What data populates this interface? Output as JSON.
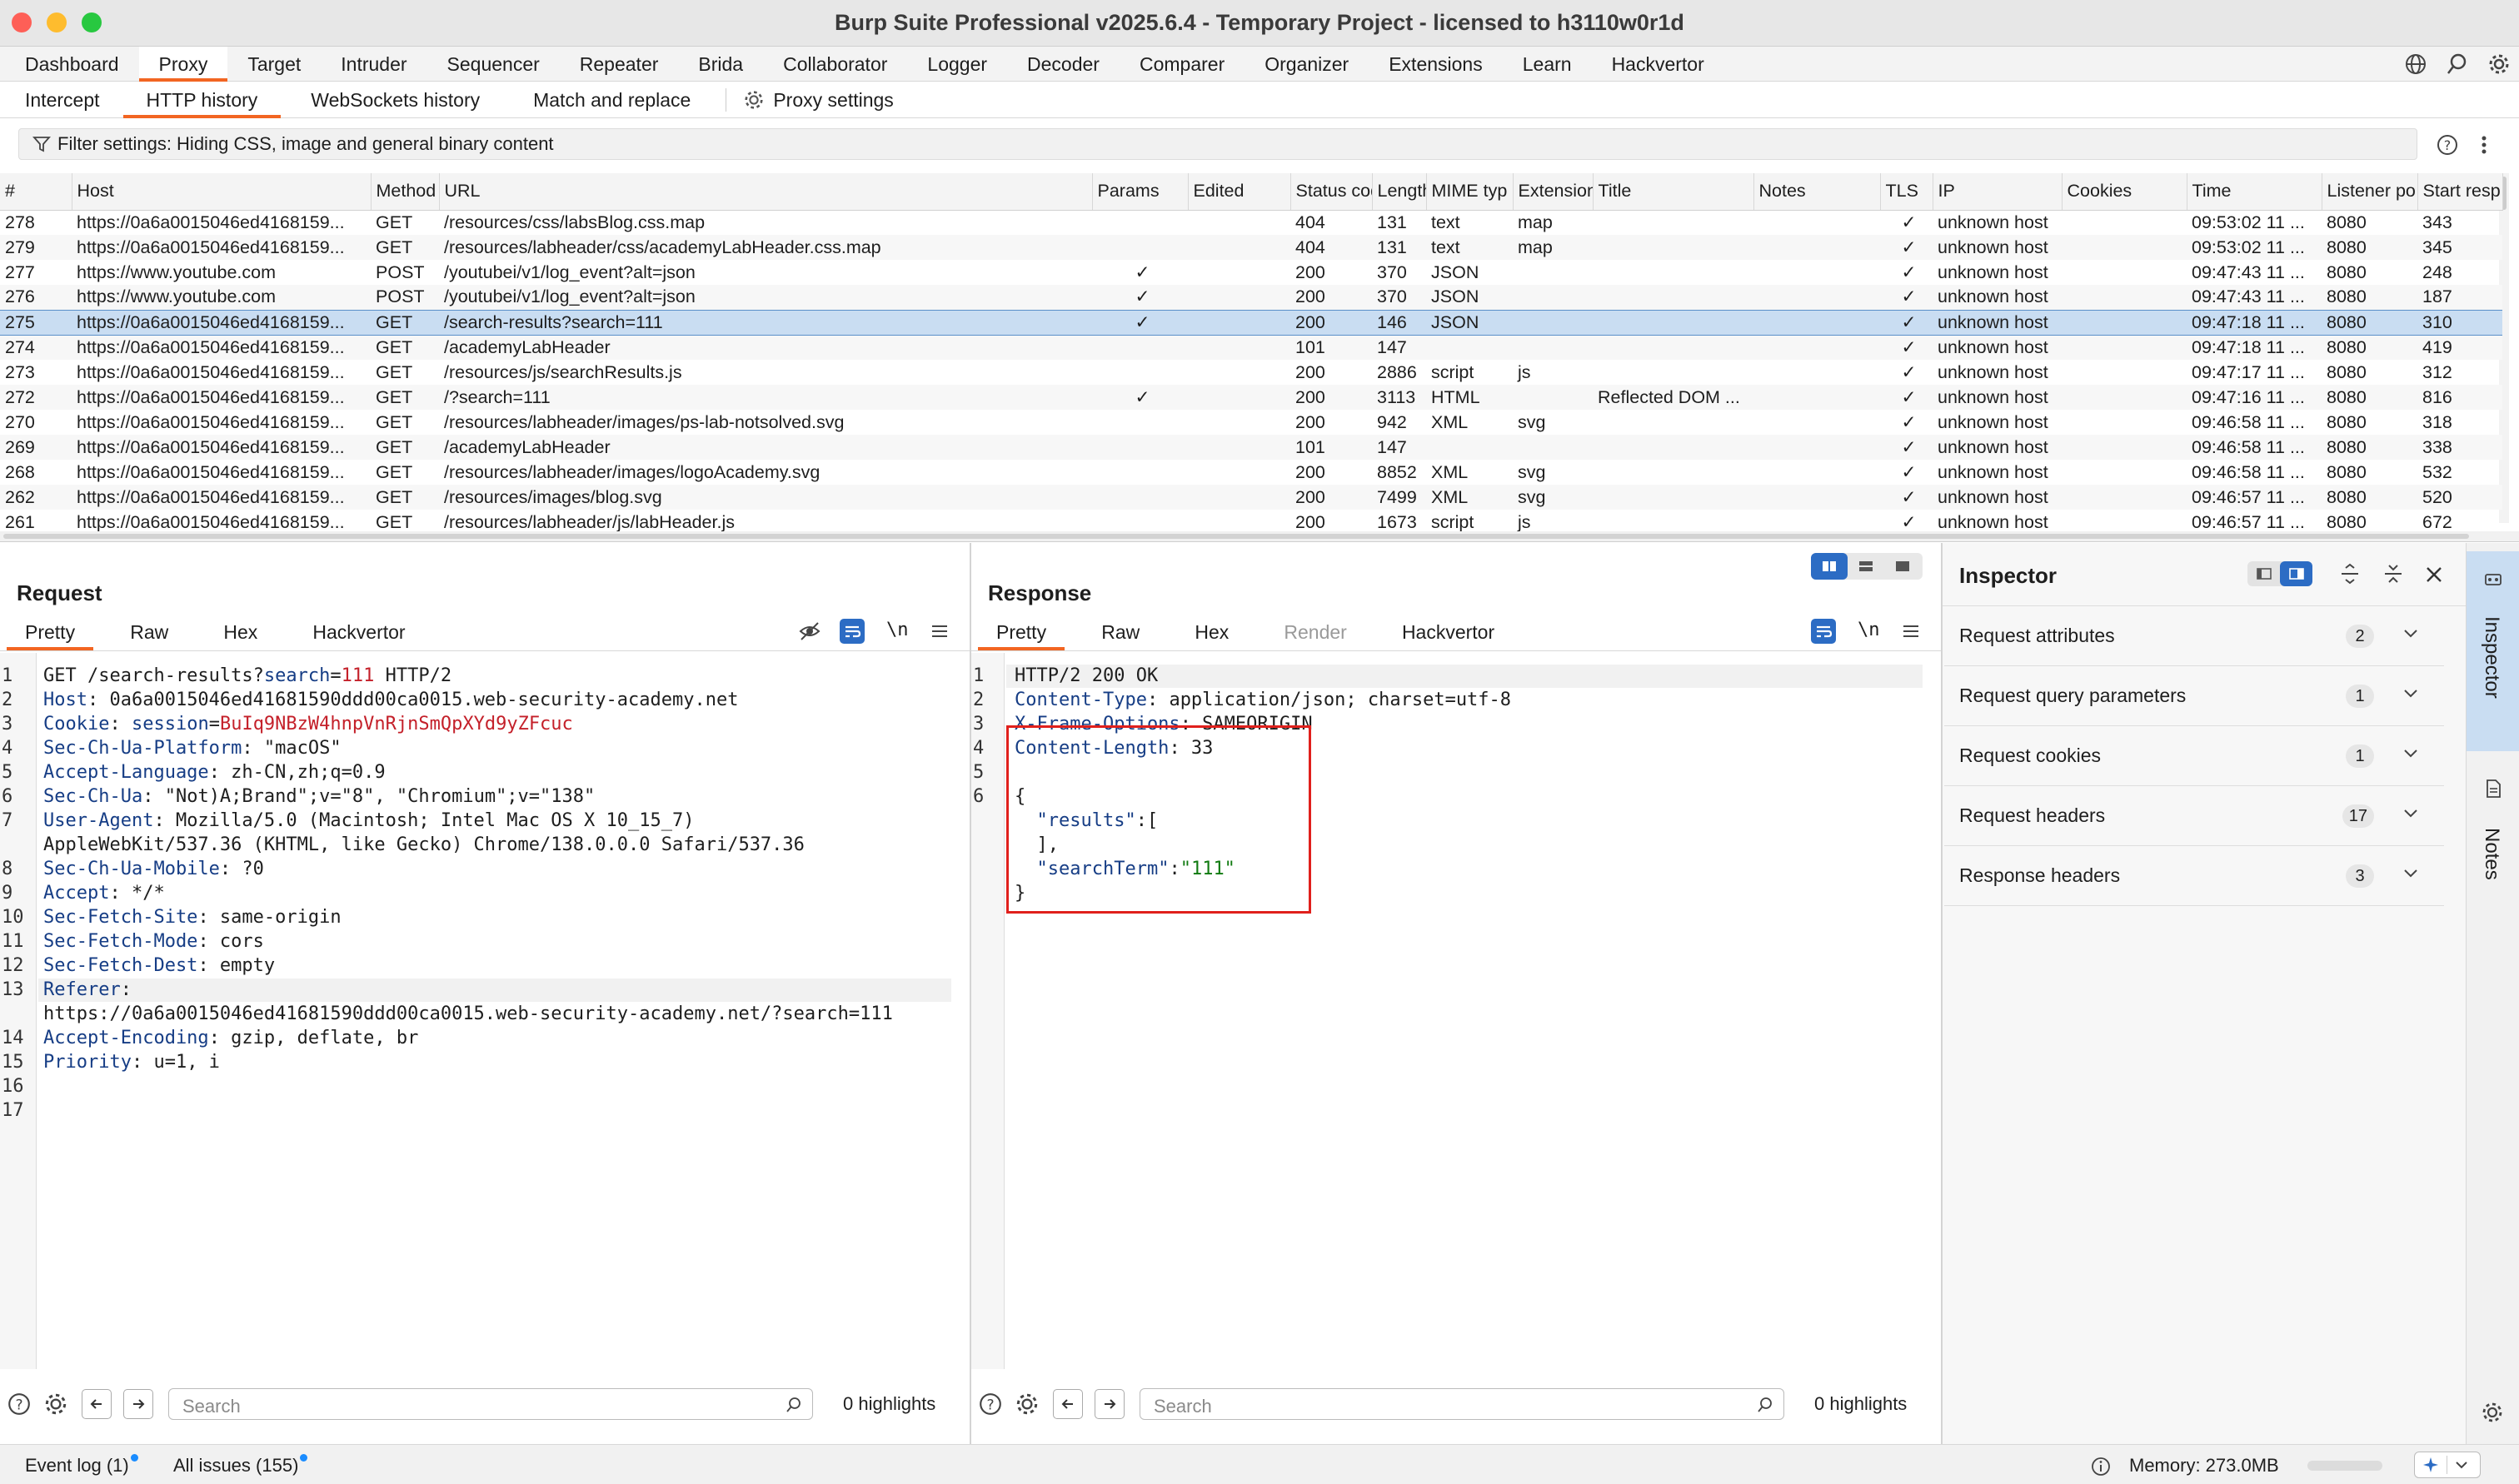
{
  "window": {
    "title": "Burp Suite Professional v2025.6.4 - Temporary Project - licensed to h3110w0r1d"
  },
  "main_tabs": [
    "Dashboard",
    "Proxy",
    "Target",
    "Intruder",
    "Sequencer",
    "Repeater",
    "Brida",
    "Collaborator",
    "Logger",
    "Decoder",
    "Comparer",
    "Organizer",
    "Extensions",
    "Learn",
    "Hackvertor"
  ],
  "active_main_tab": "Proxy",
  "sub_tabs": [
    "Intercept",
    "HTTP history",
    "WebSockets history",
    "Match and replace",
    "Proxy settings"
  ],
  "active_sub_tab": "HTTP history",
  "filter": {
    "text": "Filter settings: Hiding CSS, image and general binary content"
  },
  "table": {
    "columns": [
      "#",
      "Host",
      "Method",
      "URL",
      "Params",
      "Edited",
      "Status code",
      "Length",
      "MIME typ",
      "Extension",
      "Title",
      "Notes",
      "TLS",
      "IP",
      "Cookies",
      "Time",
      "Listener po",
      "Start resp"
    ],
    "rows": [
      [
        "278",
        "https://0a6a0015046ed4168159...",
        "GET",
        "/resources/css/labsBlog.css.map",
        "",
        "",
        "404",
        "131",
        "text",
        "map",
        "",
        "",
        "✓",
        "unknown host",
        "",
        "09:53:02 11 ...",
        "8080",
        "343"
      ],
      [
        "279",
        "https://0a6a0015046ed4168159...",
        "GET",
        "/resources/labheader/css/academyLabHeader.css.map",
        "",
        "",
        "404",
        "131",
        "text",
        "map",
        "",
        "",
        "✓",
        "unknown host",
        "",
        "09:53:02 11 ...",
        "8080",
        "345"
      ],
      [
        "277",
        "https://www.youtube.com",
        "POST",
        "/youtubei/v1/log_event?alt=json",
        "✓",
        "",
        "200",
        "370",
        "JSON",
        "",
        "",
        "",
        "✓",
        "unknown host",
        "",
        "09:47:43 11 ...",
        "8080",
        "248"
      ],
      [
        "276",
        "https://www.youtube.com",
        "POST",
        "/youtubei/v1/log_event?alt=json",
        "✓",
        "",
        "200",
        "370",
        "JSON",
        "",
        "",
        "",
        "✓",
        "unknown host",
        "",
        "09:47:43 11 ...",
        "8080",
        "187"
      ],
      [
        "275",
        "https://0a6a0015046ed4168159...",
        "GET",
        "/search-results?search=111",
        "✓",
        "",
        "200",
        "146",
        "JSON",
        "",
        "",
        "",
        "✓",
        "unknown host",
        "",
        "09:47:18 11 ...",
        "8080",
        "310"
      ],
      [
        "274",
        "https://0a6a0015046ed4168159...",
        "GET",
        "/academyLabHeader",
        "",
        "",
        "101",
        "147",
        "",
        "",
        "",
        "",
        "✓",
        "unknown host",
        "",
        "09:47:18 11 ...",
        "8080",
        "419"
      ],
      [
        "273",
        "https://0a6a0015046ed4168159...",
        "GET",
        "/resources/js/searchResults.js",
        "",
        "",
        "200",
        "2886",
        "script",
        "js",
        "",
        "",
        "✓",
        "unknown host",
        "",
        "09:47:17 11 ...",
        "8080",
        "312"
      ],
      [
        "272",
        "https://0a6a0015046ed4168159...",
        "GET",
        "/?search=111",
        "✓",
        "",
        "200",
        "3113",
        "HTML",
        "",
        "Reflected DOM ...",
        "",
        "✓",
        "unknown host",
        "",
        "09:47:16 11 ...",
        "8080",
        "816"
      ],
      [
        "270",
        "https://0a6a0015046ed4168159...",
        "GET",
        "/resources/labheader/images/ps-lab-notsolved.svg",
        "",
        "",
        "200",
        "942",
        "XML",
        "svg",
        "",
        "",
        "✓",
        "unknown host",
        "",
        "09:46:58 11 ...",
        "8080",
        "318"
      ],
      [
        "269",
        "https://0a6a0015046ed4168159...",
        "GET",
        "/academyLabHeader",
        "",
        "",
        "101",
        "147",
        "",
        "",
        "",
        "",
        "✓",
        "unknown host",
        "",
        "09:46:58 11 ...",
        "8080",
        "338"
      ],
      [
        "268",
        "https://0a6a0015046ed4168159...",
        "GET",
        "/resources/labheader/images/logoAcademy.svg",
        "",
        "",
        "200",
        "8852",
        "XML",
        "svg",
        "",
        "",
        "✓",
        "unknown host",
        "",
        "09:46:58 11 ...",
        "8080",
        "532"
      ],
      [
        "262",
        "https://0a6a0015046ed4168159...",
        "GET",
        "/resources/images/blog.svg",
        "",
        "",
        "200",
        "7499",
        "XML",
        "svg",
        "",
        "",
        "✓",
        "unknown host",
        "",
        "09:46:57 11 ...",
        "8080",
        "520"
      ],
      [
        "261",
        "https://0a6a0015046ed4168159...",
        "GET",
        "/resources/labheader/js/labHeader.js",
        "",
        "",
        "200",
        "1673",
        "script",
        "js",
        "",
        "",
        "✓",
        "unknown host",
        "",
        "09:46:57 11 ...",
        "8080",
        "672"
      ]
    ],
    "selected_row": "275"
  },
  "request": {
    "title": "Request",
    "tabs": [
      "Pretty",
      "Raw",
      "Hex",
      "Hackvertor"
    ],
    "active_tab": "Pretty",
    "newline_toggle": "\\n",
    "lines": [
      {
        "n": "1",
        "parts": [
          [
            "hv",
            "GET /search-results?"
          ],
          [
            "hk",
            "search"
          ],
          [
            "hv",
            "="
          ],
          [
            "qv",
            "111"
          ],
          [
            "hv",
            " HTTP/2"
          ]
        ]
      },
      {
        "n": "2",
        "parts": [
          [
            "hk",
            "Host"
          ],
          [
            "hv",
            ": 0a6a0015046ed41681590ddd00ca0015.web-security-academy.net"
          ]
        ]
      },
      {
        "n": "3",
        "parts": [
          [
            "hk",
            "Cookie"
          ],
          [
            "hv",
            ": "
          ],
          [
            "hk",
            "session"
          ],
          [
            "hv",
            "="
          ],
          [
            "pk",
            "BuIq9NBzW4hnpVnRjnSmQpXYd9yZFcuc"
          ]
        ]
      },
      {
        "n": "4",
        "parts": [
          [
            "hk",
            "Sec-Ch-Ua-Platform"
          ],
          [
            "hv",
            ": \"macOS\""
          ]
        ]
      },
      {
        "n": "5",
        "parts": [
          [
            "hk",
            "Accept-Language"
          ],
          [
            "hv",
            ": zh-CN,zh;q=0.9"
          ]
        ]
      },
      {
        "n": "6",
        "parts": [
          [
            "hk",
            "Sec-Ch-Ua"
          ],
          [
            "hv",
            ": \"Not)A;Brand\";v=\"8\", \"Chromium\";v=\"138\""
          ]
        ]
      },
      {
        "n": "7",
        "parts": [
          [
            "hk",
            "User-Agent"
          ],
          [
            "hv",
            ": Mozilla/5.0 (Macintosh; Intel Mac OS X 10_15_7)"
          ]
        ]
      },
      {
        "n": "",
        "parts": [
          [
            "hv",
            "AppleWebKit/537.36 (KHTML, like Gecko) Chrome/138.0.0.0 Safari/537.36"
          ]
        ]
      },
      {
        "n": "8",
        "parts": [
          [
            "hk",
            "Sec-Ch-Ua-Mobile"
          ],
          [
            "hv",
            ": ?0"
          ]
        ]
      },
      {
        "n": "9",
        "parts": [
          [
            "hk",
            "Accept"
          ],
          [
            "hv",
            ": */*"
          ]
        ]
      },
      {
        "n": "10",
        "parts": [
          [
            "hk",
            "Sec-Fetch-Site"
          ],
          [
            "hv",
            ": same-origin"
          ]
        ]
      },
      {
        "n": "11",
        "parts": [
          [
            "hk",
            "Sec-Fetch-Mode"
          ],
          [
            "hv",
            ": cors"
          ]
        ]
      },
      {
        "n": "12",
        "parts": [
          [
            "hk",
            "Sec-Fetch-Dest"
          ],
          [
            "hv",
            ": empty"
          ]
        ]
      },
      {
        "n": "13",
        "parts": [
          [
            "hk",
            "Referer"
          ],
          [
            "hv",
            ": "
          ]
        ]
      },
      {
        "n": "",
        "parts": [
          [
            "hv",
            "https://0a6a0015046ed41681590ddd00ca0015.web-security-academy.net/?search=111"
          ]
        ]
      },
      {
        "n": "14",
        "parts": [
          [
            "hk",
            "Accept-Encoding"
          ],
          [
            "hv",
            ": gzip, deflate, br"
          ]
        ]
      },
      {
        "n": "15",
        "parts": [
          [
            "hk",
            "Priority"
          ],
          [
            "hv",
            ": u=1, i"
          ]
        ]
      },
      {
        "n": "16",
        "parts": []
      },
      {
        "n": "17",
        "parts": []
      }
    ],
    "search_placeholder": "Search",
    "highlights": "0 highlights"
  },
  "response": {
    "title": "Response",
    "tabs": [
      "Pretty",
      "Raw",
      "Hex",
      "Render",
      "Hackvertor"
    ],
    "active_tab": "Pretty",
    "newline_toggle": "\\n",
    "lines": [
      {
        "n": "1",
        "parts": [
          [
            "hv",
            "HTTP/2 200 OK"
          ]
        ]
      },
      {
        "n": "2",
        "parts": [
          [
            "hk",
            "Content-Type"
          ],
          [
            "hv",
            ": application/json; charset=utf-8"
          ]
        ]
      },
      {
        "n": "3",
        "parts": [
          [
            "hk",
            "X-Frame-Options"
          ],
          [
            "hv",
            ": SAMEORIGIN"
          ]
        ]
      },
      {
        "n": "4",
        "parts": [
          [
            "hk",
            "Content-Length"
          ],
          [
            "hv",
            ": 33"
          ]
        ]
      },
      {
        "n": "5",
        "parts": []
      },
      {
        "n": "6",
        "parts": [
          [
            "hv",
            "{"
          ]
        ]
      },
      {
        "n": "",
        "parts": [
          [
            "hv",
            "  "
          ],
          [
            "jk",
            "\"results\""
          ],
          [
            "hv",
            ":["
          ]
        ]
      },
      {
        "n": "",
        "parts": [
          [
            "hv",
            "  ],"
          ]
        ]
      },
      {
        "n": "",
        "parts": [
          [
            "hv",
            "  "
          ],
          [
            "jk",
            "\"searchTerm\""
          ],
          [
            "hv",
            ":"
          ],
          [
            "js",
            "\"111\""
          ]
        ]
      },
      {
        "n": "",
        "parts": [
          [
            "hv",
            "}"
          ]
        ]
      }
    ],
    "search_placeholder": "Search",
    "highlights": "0 highlights"
  },
  "inspector": {
    "title": "Inspector",
    "sections": [
      {
        "label": "Request attributes",
        "count": "2"
      },
      {
        "label": "Request query parameters",
        "count": "1"
      },
      {
        "label": "Request cookies",
        "count": "1"
      },
      {
        "label": "Request headers",
        "count": "17"
      },
      {
        "label": "Response headers",
        "count": "3"
      }
    ],
    "side_tabs": [
      "Inspector",
      "Notes"
    ]
  },
  "statusbar": {
    "event_log": "Event log (1)",
    "all_issues": "All issues (155)",
    "memory": "Memory: 273.0MB"
  },
  "colors": {
    "accent_orange": "#f26522",
    "selection_blue": "#c9ddf2",
    "highlight_box": "#e0201c"
  }
}
